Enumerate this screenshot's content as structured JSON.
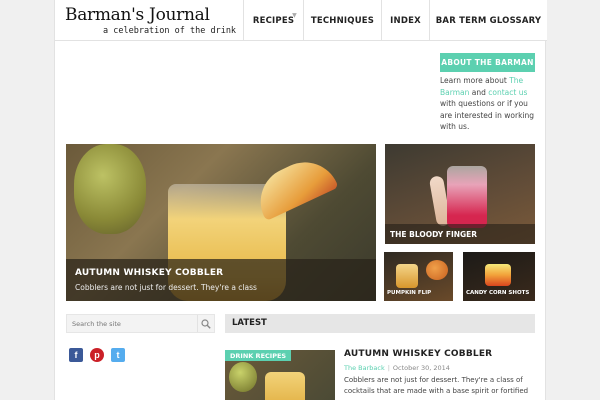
{
  "header": {
    "title": "Barman's Journal",
    "tagline": "a celebration of the drink",
    "nav": [
      {
        "label": "RECIPES",
        "has_dropdown": true
      },
      {
        "label": "TECHNIQUES"
      },
      {
        "label": "INDEX"
      },
      {
        "label": "BAR TERM GLOSSARY"
      }
    ]
  },
  "sidebar_about": {
    "button_label": "ABOUT THE BARMAN",
    "text_1": "Learn more about ",
    "link_1": "The Barman",
    "text_2": " and ",
    "link_2": "contact us",
    "text_3": " with questions or if you are interested in working with us."
  },
  "featured": {
    "main": {
      "title": "AUTUMN WHISKEY COBBLER",
      "subtitle": "Cobblers are not just for dessert. They're a class"
    },
    "side_top": {
      "title": "THE BLOODY FINGER"
    },
    "small_1": {
      "title": "PUMPKIN FLIP"
    },
    "small_2": {
      "title": "CANDY CORN SHOTS"
    }
  },
  "search": {
    "placeholder": "Search the site"
  },
  "latest": {
    "heading": "LATEST",
    "post": {
      "category": "DRINK RECIPES",
      "title": "AUTUMN WHISKEY COBBLER",
      "author": "The Barback",
      "date": "October 30, 2014",
      "excerpt": "Cobblers are not just for dessert. They're a class of cocktails that are made with a base spirit or fortified"
    }
  },
  "colors": {
    "accent": "#5cd0b0",
    "facebook": "#3b5998",
    "pinterest": "#cb2027",
    "twitter": "#55acee"
  },
  "icons": {
    "search": "search-icon",
    "facebook": "facebook-icon",
    "pinterest": "pinterest-icon",
    "twitter": "twitter-icon"
  }
}
